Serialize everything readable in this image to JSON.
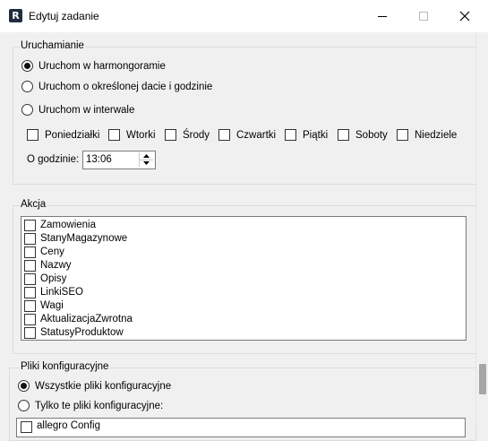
{
  "window": {
    "app_icon_letter": "R",
    "title": "Edytuj zadanie"
  },
  "run": {
    "legend": "Uruchamianie",
    "options": [
      {
        "label": "Uruchom w harmongoramie",
        "checked": true
      },
      {
        "label": "Uruchom o określonej dacie i godzinie",
        "checked": false
      },
      {
        "label": "Uruchom w interwale",
        "checked": false
      }
    ],
    "days": [
      {
        "label": "Poniedziałki",
        "checked": false
      },
      {
        "label": "Wtorki",
        "checked": false
      },
      {
        "label": "Środy",
        "checked": false
      },
      {
        "label": "Czwartki",
        "checked": false
      },
      {
        "label": "Piątki",
        "checked": false
      },
      {
        "label": "Soboty",
        "checked": false
      },
      {
        "label": "Niedziele",
        "checked": false
      }
    ],
    "time_label": "O godzinie:",
    "time_value": "13:06"
  },
  "action": {
    "legend": "Akcja",
    "items": [
      {
        "label": "Zamowienia",
        "checked": false
      },
      {
        "label": "StanyMagazynowe",
        "checked": false
      },
      {
        "label": "Ceny",
        "checked": false
      },
      {
        "label": "Nazwy",
        "checked": false
      },
      {
        "label": "Opisy",
        "checked": false
      },
      {
        "label": "LinkiSEO",
        "checked": false
      },
      {
        "label": "Wagi",
        "checked": false
      },
      {
        "label": "AktualizacjaZwrotna",
        "checked": false
      },
      {
        "label": "StatusyProduktow",
        "checked": false
      }
    ]
  },
  "config": {
    "legend": "Pliki konfiguracyjne",
    "options": [
      {
        "label": "Wszystkie pliki konfiguracyjne",
        "checked": true
      },
      {
        "label": "Tylko te pliki konfiguracyjne:",
        "checked": false
      }
    ],
    "files": [
      {
        "label": "allegro Config",
        "checked": false
      }
    ]
  }
}
